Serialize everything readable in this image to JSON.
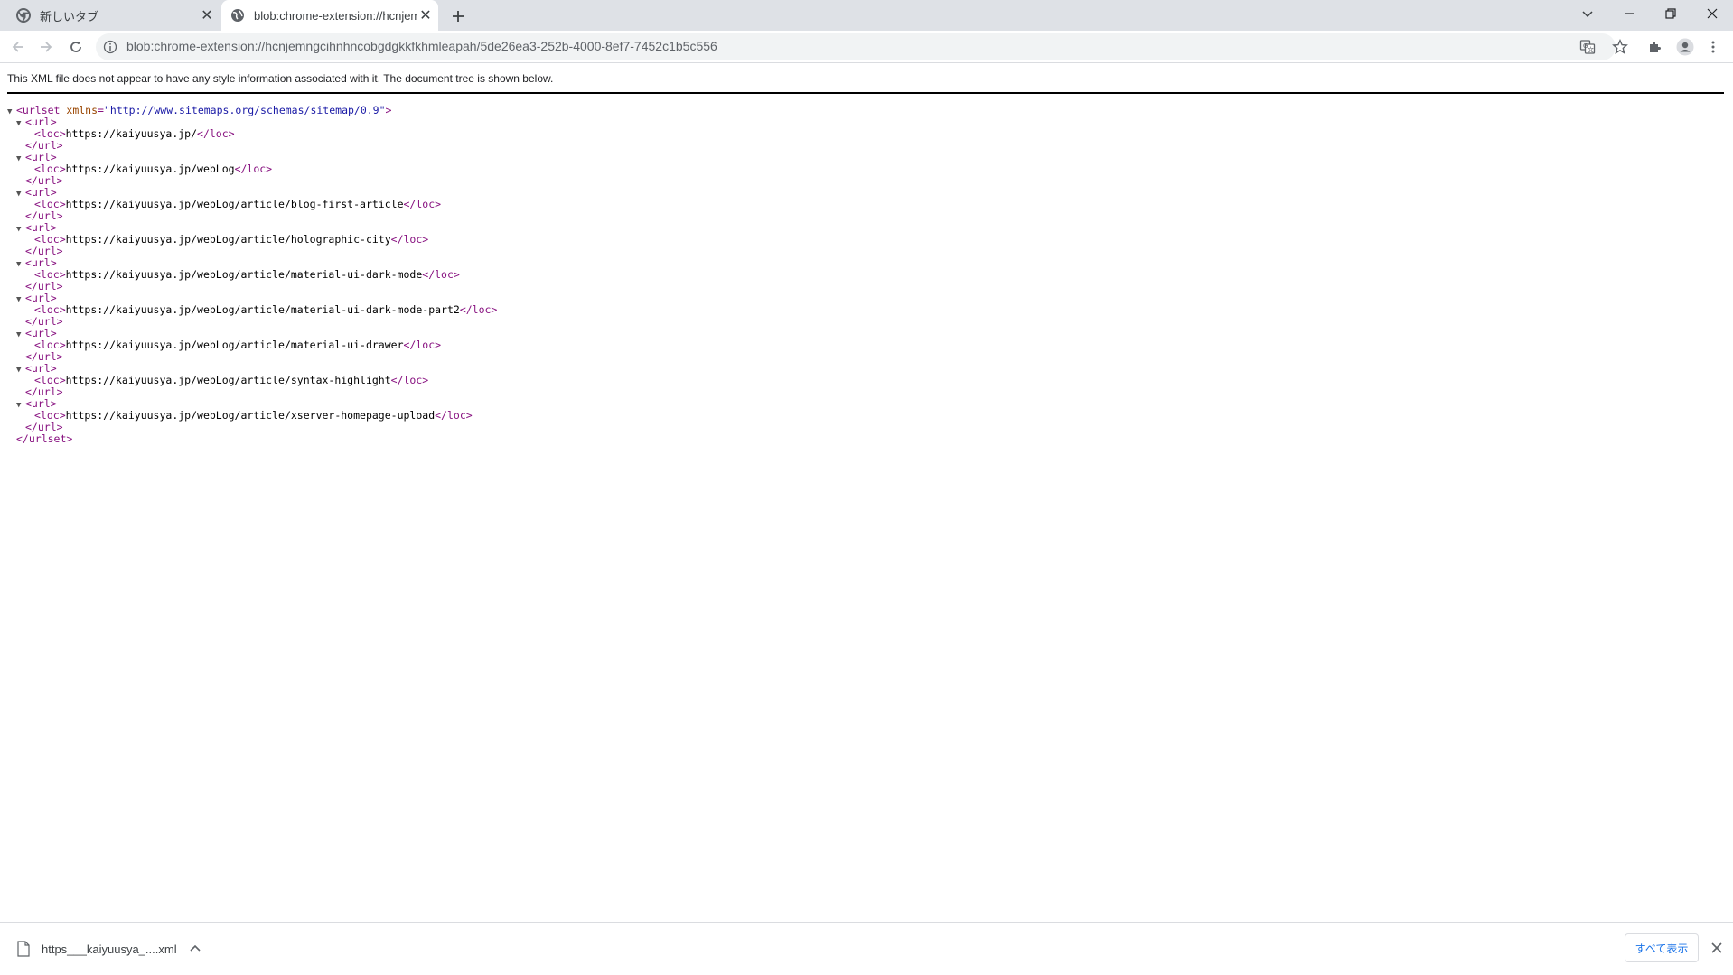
{
  "tabs": [
    {
      "title": "新しいタブ",
      "active": false,
      "favicon": "chrome-icon"
    },
    {
      "title": "blob:chrome-extension://hcnjemngcihnhncobgdgkkfkhmleapah/5de26ea3-252b-4000-8ef7-7452c1b5c556",
      "active": true,
      "favicon": "globe-icon"
    }
  ],
  "address_bar": {
    "url": "blob:chrome-extension://hcnjemngcihnhncobgdgkkfkhmleapah/5de26ea3-252b-4000-8ef7-7452c1b5c556"
  },
  "content": {
    "info_message": "This XML file does not appear to have any style information associated with it. The document tree is shown below.",
    "urlset_open": "<urlset",
    "xmlns_attr": "xmlns",
    "xmlns_value": "\"http://www.sitemaps.org/schemas/sitemap/0.9\"",
    "urlset_close": "</urlset>",
    "url_open": "<url>",
    "url_close": "</url>",
    "loc_open": "<loc>",
    "loc_close": "</loc>",
    "locs": [
      "https://kaiyuusya.jp/",
      "https://kaiyuusya.jp/webLog",
      "https://kaiyuusya.jp/webLog/article/blog-first-article",
      "https://kaiyuusya.jp/webLog/article/holographic-city",
      "https://kaiyuusya.jp/webLog/article/material-ui-dark-mode",
      "https://kaiyuusya.jp/webLog/article/material-ui-dark-mode-part2",
      "https://kaiyuusya.jp/webLog/article/material-ui-drawer",
      "https://kaiyuusya.jp/webLog/article/syntax-highlight",
      "https://kaiyuusya.jp/webLog/article/xserver-homepage-upload"
    ]
  },
  "download_shelf": {
    "file_name": "https___kaiyuusya_....xml",
    "show_all_label": "すべて表示"
  },
  "colors": {
    "tag": "#881280",
    "attribute": "#994500",
    "attribute_value": "#1a1aa6",
    "link_blue": "#1a73e8"
  }
}
